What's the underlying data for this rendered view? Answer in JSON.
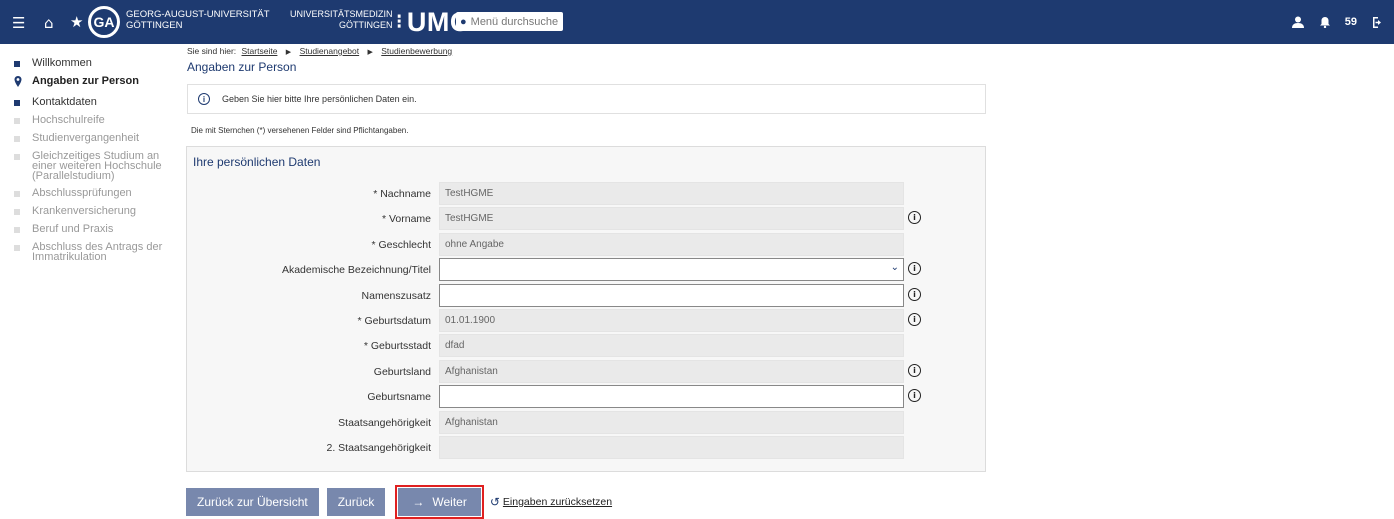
{
  "header": {
    "logo_ga": "GA",
    "logo_text_line1": "GEORG-AUGUST-UNIVERSITÄT",
    "logo_text_line2": "GÖTTINGEN",
    "umg_small_line1": "UNIVERSITÄTSMEDIZIN",
    "umg_small_line2": "GÖTTINGEN",
    "umg_label": "UMG",
    "search_placeholder": "Menü durchsuche",
    "notification_count": "59"
  },
  "breadcrumb": {
    "prefix": "Sie sind hier:",
    "items": [
      "Startseite",
      "Studienangebot",
      "Studienbewerbung"
    ]
  },
  "page_title": "Angaben zur Person",
  "sidebar": {
    "items": [
      {
        "label": "Willkommen",
        "state": "active"
      },
      {
        "label": "Angaben zur Person",
        "state": "current"
      },
      {
        "label": "Kontaktdaten",
        "state": "active"
      },
      {
        "label": "Hochschulreife",
        "state": "inactive"
      },
      {
        "label": "Studienvergangenheit",
        "state": "inactive"
      },
      {
        "label": "Gleichzeitiges Studium an einer weiteren Hochschule (Parallelstudium)",
        "state": "inactive"
      },
      {
        "label": "Abschlussprüfungen",
        "state": "inactive"
      },
      {
        "label": "Krankenversicherung",
        "state": "inactive"
      },
      {
        "label": "Beruf und Praxis",
        "state": "inactive"
      },
      {
        "label": "Abschluss des Antrags der Immatrikulation",
        "state": "inactive"
      }
    ]
  },
  "info_message": "Geben Sie hier bitte Ihre persönlichen Daten ein.",
  "required_note": "Die mit Sternchen (*) versehenen Felder sind Pflichtangaben.",
  "panel_title": "Ihre persönlichen Daten",
  "fields": [
    {
      "label": "* Nachname",
      "value": "TestHGME",
      "editable": false,
      "info": false
    },
    {
      "label": "* Vorname",
      "value": "TestHGME",
      "editable": false,
      "info": true
    },
    {
      "label": "* Geschlecht",
      "value": "ohne Angabe",
      "editable": false,
      "info": false
    },
    {
      "label": "Akademische Bezeichnung/Titel",
      "value": "",
      "editable": true,
      "info": true,
      "select": true
    },
    {
      "label": "Namenszusatz",
      "value": "",
      "editable": true,
      "info": true
    },
    {
      "label": "* Geburtsdatum",
      "value": "01.01.1900",
      "editable": false,
      "info": true
    },
    {
      "label": "* Geburtsstadt",
      "value": "dfad",
      "editable": false,
      "info": false
    },
    {
      "label": "Geburtsland",
      "value": "Afghanistan",
      "editable": false,
      "info": true
    },
    {
      "label": "Geburtsname",
      "value": "",
      "editable": true,
      "info": true
    },
    {
      "label": "Staatsangehörigkeit",
      "value": "Afghanistan",
      "editable": false,
      "info": false
    },
    {
      "label": "2. Staatsangehörigkeit",
      "value": "",
      "editable": false,
      "info": false
    }
  ],
  "actions": {
    "back_overview": "Zurück zur Übersicht",
    "back": "Zurück",
    "next": "Weiter",
    "reset": "Eingaben zurücksetzen"
  }
}
